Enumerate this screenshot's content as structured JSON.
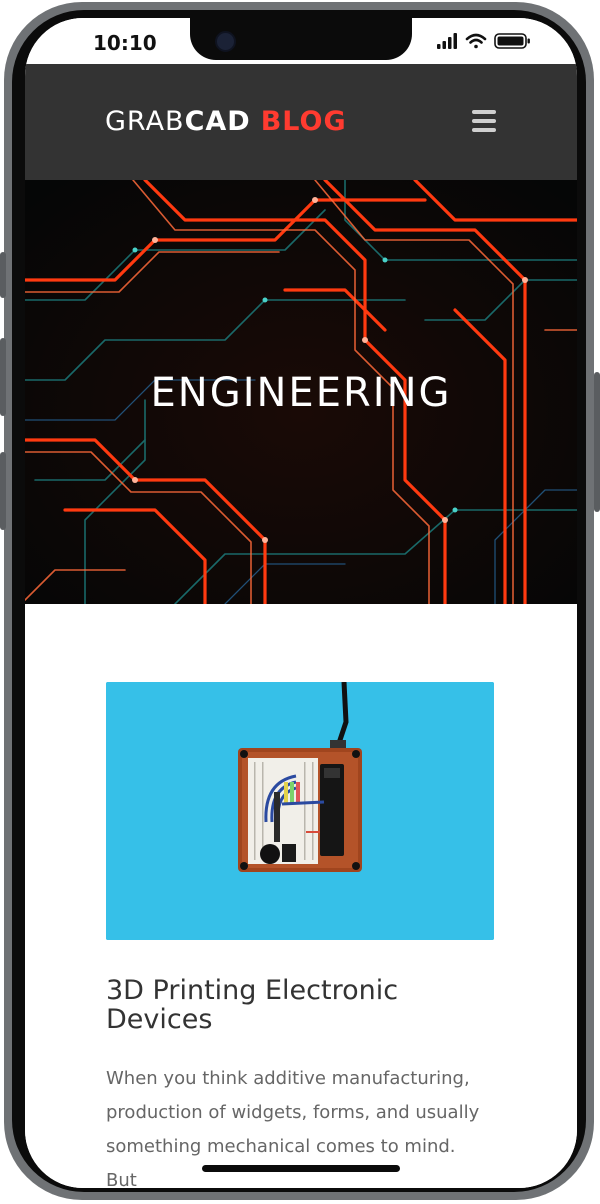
{
  "status_bar": {
    "time": "10:10"
  },
  "header": {
    "logo_part1": "GRAB",
    "logo_part2": "CAD",
    "logo_part3": "BLOG",
    "menu_icon": "hamburger-menu-icon"
  },
  "hero": {
    "title": "ENGINEERING"
  },
  "post": {
    "title": "3D Printing Electronic Devices",
    "excerpt": "When you think additive manufacturing, production of widgets, forms, and usually something mechanical comes to mind. But"
  },
  "colors": {
    "brand_red": "#ff3b30",
    "header_bg": "#333333",
    "thumb_bg": "#36c0e8"
  }
}
